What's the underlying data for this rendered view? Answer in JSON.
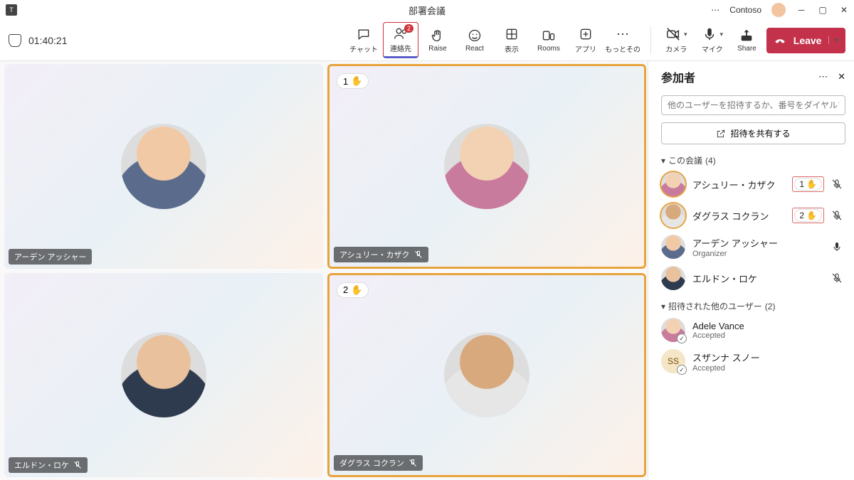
{
  "app": {
    "title": "部署会議",
    "org": "Contoso"
  },
  "toolbar": {
    "timer": "01:40:21",
    "chat": "チャット",
    "people": "連絡先",
    "people_badge": "2",
    "raise": "Raise",
    "react": "React",
    "view": "表示",
    "rooms": "Rooms",
    "apps": "アプリ",
    "more": "もっとその",
    "camera": "カメラ",
    "mic": "マイク",
    "share": "Share",
    "leave": "Leave"
  },
  "tiles": [
    {
      "name": "アーデン アッシャー",
      "muted": false,
      "raised": false
    },
    {
      "name": "アシュリー・カザク",
      "muted": true,
      "raised": true,
      "order": "1"
    },
    {
      "name": "エルドン・ロケ",
      "muted": true,
      "raised": false
    },
    {
      "name": "ダグラス コクラン",
      "muted": true,
      "raised": true,
      "order": "2"
    }
  ],
  "panel": {
    "title": "参加者",
    "invite_placeholder": "他のユーザーを招待するか、番号をダイヤルする",
    "share_invite": "招待を共有する",
    "section_in": "この会議",
    "section_in_count": "(4)",
    "section_other": "招待された他のユーザー",
    "section_other_count": "(2)",
    "in_meeting": [
      {
        "name": "アシュリー・カザク",
        "raised_order": "1",
        "muted": true,
        "ring": true
      },
      {
        "name": "ダグラス コクラン",
        "raised_order": "2",
        "muted": true,
        "ring": true
      },
      {
        "name": "アーデン アッシャー",
        "sub": "Organizer",
        "muted": false
      },
      {
        "name": "エルドン・ロケ",
        "muted": true
      }
    ],
    "invited": [
      {
        "name": "Adele Vance",
        "sub": "Accepted"
      },
      {
        "name": "スザンナ スノー",
        "sub": "Accepted",
        "initials": "SS"
      }
    ]
  }
}
